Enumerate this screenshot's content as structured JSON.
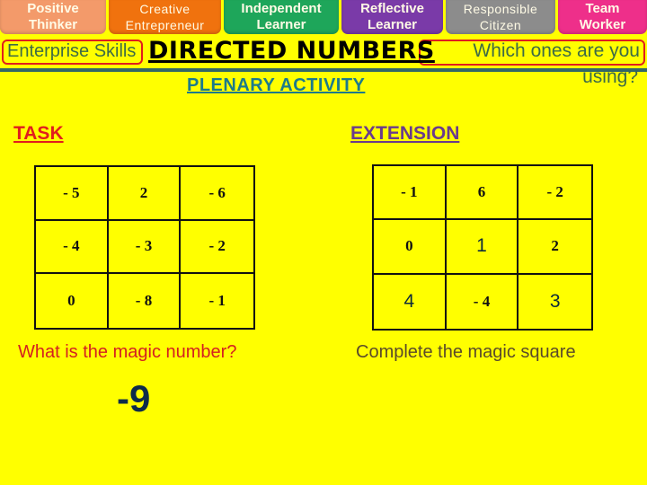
{
  "skill_tabs": [
    {
      "line1": "Positive",
      "line2": "Thinker",
      "color": "#f39a6a"
    },
    {
      "line1": "Creative",
      "line2": "Entrepreneur",
      "color": "#f0720e"
    },
    {
      "line1": "Independent",
      "line2": "Learner",
      "color": "#1ea65a"
    },
    {
      "line1": "Reflective",
      "line2": "Learner",
      "color": "#7a3aa8"
    },
    {
      "line1": "Responsible",
      "line2": "Citizen",
      "color": "#8c8c8c"
    },
    {
      "line1": "Team",
      "line2": "Worker",
      "color": "#ee2f8a"
    }
  ],
  "header": {
    "enterprise_label": "Enterprise Skills",
    "title": "DIRECTED NUMBERS",
    "which_line1": "Which ones are you",
    "which_line2": "using?",
    "subtitle": "PLENARY ACTIVITY"
  },
  "task": {
    "heading": "TASK",
    "grid": [
      [
        "- 5",
        "2",
        "- 6"
      ],
      [
        "-  4",
        "- 3",
        "- 2"
      ],
      [
        "0",
        "- 8",
        "- 1"
      ]
    ],
    "question": "What is the magic number?",
    "answer": "-9"
  },
  "extension": {
    "heading": "EXTENSION",
    "grid": [
      [
        "- 1",
        "6",
        "- 2"
      ],
      [
        "0",
        "1",
        "2"
      ],
      [
        "4",
        "- 4",
        "3"
      ]
    ],
    "instruction": "Complete the magic square"
  },
  "colors": {
    "background": "#ffff00",
    "title": "#000000",
    "subtitle": "#1b7a8c",
    "task_heading": "#e11d1d",
    "extension_heading": "#6a3b8c"
  }
}
